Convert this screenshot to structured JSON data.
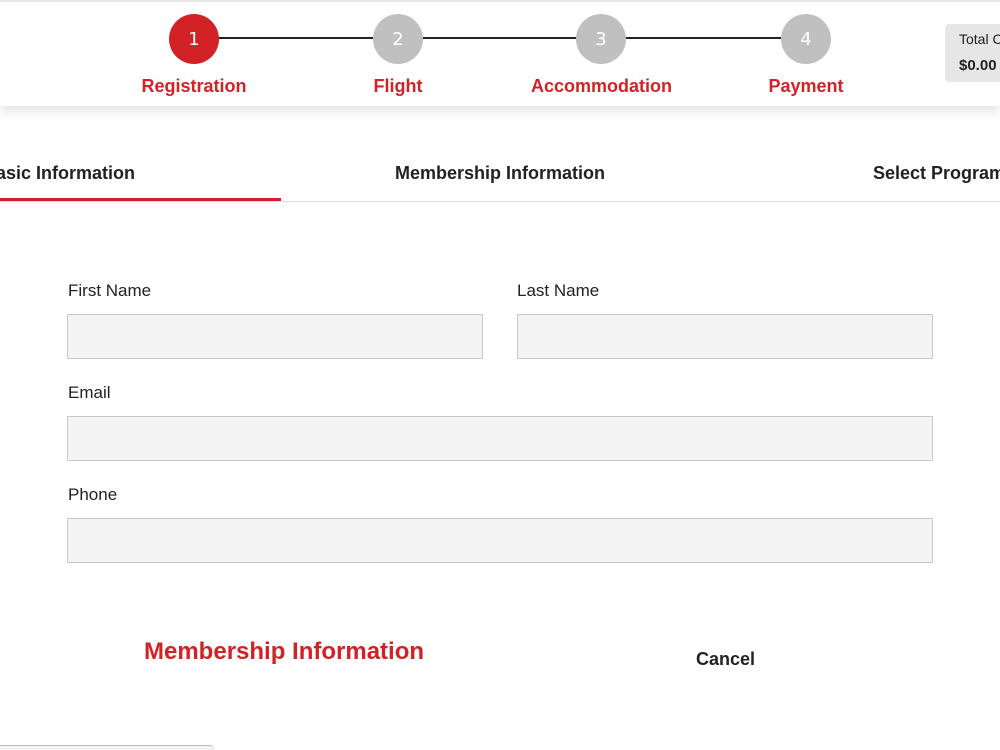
{
  "stepper": {
    "steps": [
      {
        "number": "1",
        "label": "Registration",
        "state": "active"
      },
      {
        "number": "2",
        "label": "Flight",
        "state": "inactive"
      },
      {
        "number": "3",
        "label": "Accommodation",
        "state": "inactive"
      },
      {
        "number": "4",
        "label": "Payment",
        "state": "inactive"
      }
    ],
    "total": {
      "label": "Total C",
      "value": "$0.00"
    }
  },
  "tabs": [
    {
      "label": "asic Information",
      "selected": true
    },
    {
      "label": "Membership Information",
      "selected": false
    },
    {
      "label": "Select Program",
      "selected": false
    }
  ],
  "form": {
    "first_name": {
      "label": "First Name",
      "value": ""
    },
    "last_name": {
      "label": "Last Name",
      "value": ""
    },
    "email": {
      "label": "Email",
      "value": ""
    },
    "phone": {
      "label": "Phone",
      "value": ""
    }
  },
  "actions": {
    "next_label": "Membership Information",
    "cancel_label": "Cancel"
  },
  "colors": {
    "accent": "#d32226",
    "inactive_step": "#c0c0c0",
    "input_background": "#f4f4f4"
  }
}
